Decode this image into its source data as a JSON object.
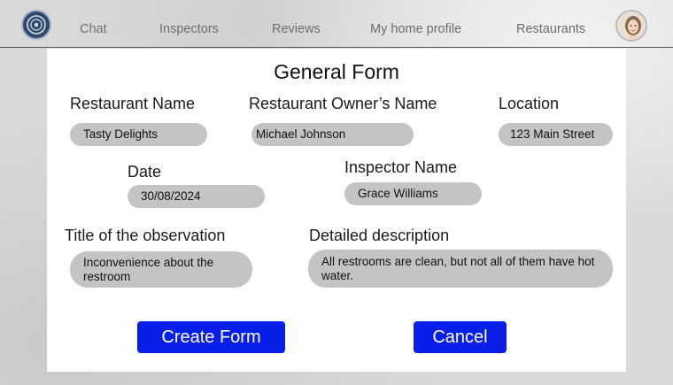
{
  "nav": {
    "items": [
      {
        "label": "Chat"
      },
      {
        "label": "Inspectors"
      },
      {
        "label": "Reviews"
      },
      {
        "label": "My home profile"
      },
      {
        "label": "Restaurants"
      }
    ]
  },
  "form": {
    "title": "General Form",
    "restaurant_name": {
      "label": "Restaurant Name",
      "value": "Tasty Delights"
    },
    "owner_name": {
      "label": "Restaurant Owner’s Name",
      "value": "Michael Johnson"
    },
    "location": {
      "label": "Location",
      "value": "123 Main Street"
    },
    "date": {
      "label": "Date",
      "value": "30/08/2024"
    },
    "inspector_name": {
      "label": "Inspector Name",
      "value": "Grace Williams"
    },
    "observation_title": {
      "label": "Title of the observation",
      "value": "Inconvenience about the restroom"
    },
    "description": {
      "label": "Detailed description",
      "value": "All restrooms are clean, but not all of them have hot water."
    },
    "create_label": "Create Form",
    "cancel_label": "Cancel"
  },
  "colors": {
    "button": "#0a1eea",
    "field": "#c4c4c4",
    "nav_text": "#6d6d6d"
  }
}
